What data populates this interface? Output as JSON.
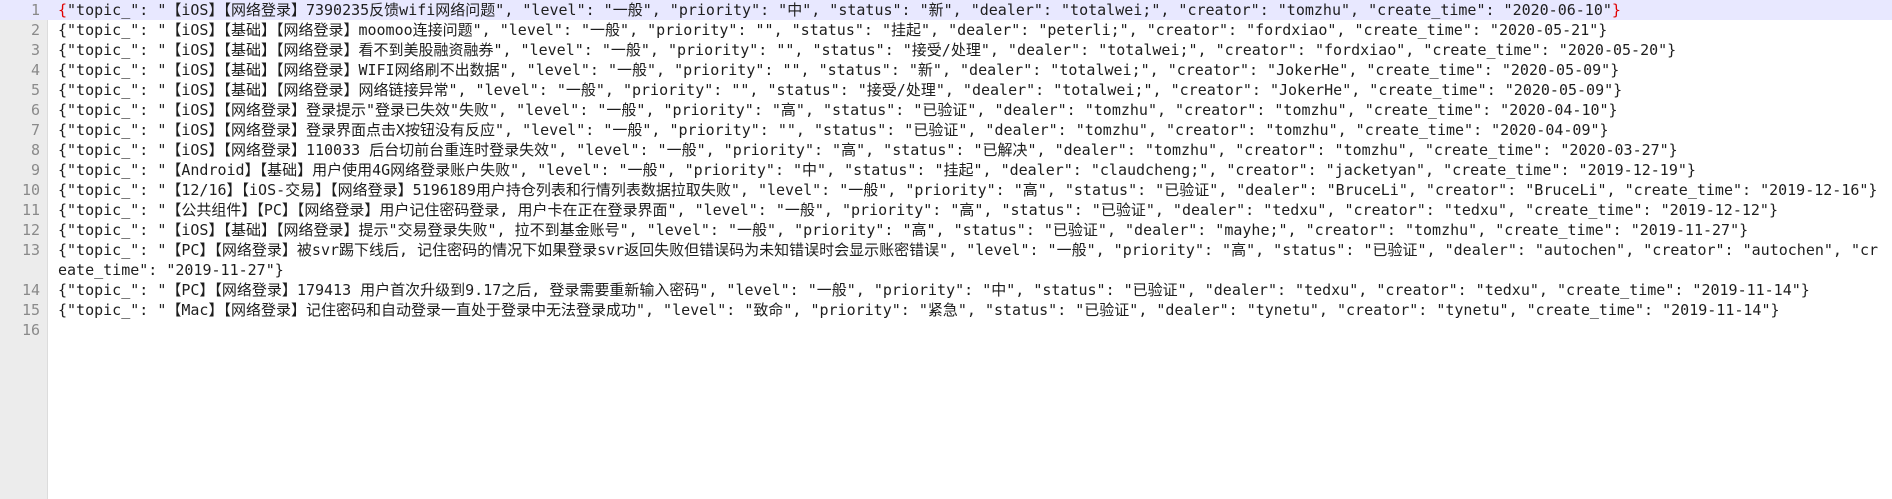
{
  "editor": {
    "lines": [
      {
        "number": "1",
        "open": "{",
        "text": "\"topic_\": \"【iOS】【网络登录】7390235反馈wifi网络问题\", \"level\": \"一般\", \"priority\": \"中\", \"status\": \"新\", \"dealer\": \"totalwei;\", \"creator\": \"tomzhu\", \"create_time\": \"2020-06-10\"",
        "close": "}"
      },
      {
        "number": "2",
        "open": "",
        "text": "{\"topic_\": \"【iOS】【基础】【网络登录】moomoo连接问题\", \"level\": \"一般\", \"priority\": \"\", \"status\": \"挂起\", \"dealer\": \"peterli;\", \"creator\": \"fordxiao\", \"create_time\": \"2020-05-21\"}",
        "close": ""
      },
      {
        "number": "3",
        "open": "",
        "text": "{\"topic_\": \"【iOS】【基础】【网络登录】看不到美股融资融券\", \"level\": \"一般\", \"priority\": \"\", \"status\": \"接受/处理\", \"dealer\": \"totalwei;\", \"creator\": \"fordxiao\", \"create_time\": \"2020-05-20\"}",
        "close": ""
      },
      {
        "number": "4",
        "open": "",
        "text": "{\"topic_\": \"【iOS】【基础】【网络登录】WIFI网络刷不出数据\", \"level\": \"一般\", \"priority\": \"\", \"status\": \"新\", \"dealer\": \"totalwei;\", \"creator\": \"JokerHe\", \"create_time\": \"2020-05-09\"}",
        "close": ""
      },
      {
        "number": "5",
        "open": "",
        "text": "{\"topic_\": \"【iOS】【基础】【网络登录】网络链接异常\", \"level\": \"一般\", \"priority\": \"\", \"status\": \"接受/处理\", \"dealer\": \"totalwei;\", \"creator\": \"JokerHe\", \"create_time\": \"2020-05-09\"}",
        "close": ""
      },
      {
        "number": "6",
        "open": "",
        "text": "{\"topic_\": \"【iOS】【网络登录】登录提示\"登录已失效\"失败\", \"level\": \"一般\", \"priority\": \"高\", \"status\": \"已验证\", \"dealer\": \"tomzhu\", \"creator\": \"tomzhu\", \"create_time\": \"2020-04-10\"}",
        "close": ""
      },
      {
        "number": "7",
        "open": "",
        "text": "{\"topic_\": \"【iOS】【网络登录】登录界面点击X按钮没有反应\", \"level\": \"一般\", \"priority\": \"\", \"status\": \"已验证\", \"dealer\": \"tomzhu\", \"creator\": \"tomzhu\", \"create_time\": \"2020-04-09\"}",
        "close": ""
      },
      {
        "number": "8",
        "open": "",
        "text": "{\"topic_\": \"【iOS】【网络登录】110033 后台切前台重连时登录失效\", \"level\": \"一般\", \"priority\": \"高\", \"status\": \"已解决\", \"dealer\": \"tomzhu\", \"creator\": \"tomzhu\", \"create_time\": \"2020-03-27\"}",
        "close": ""
      },
      {
        "number": "9",
        "open": "",
        "text": "{\"topic_\": \"【Android】【基础】用户使用4G网络登录账户失败\", \"level\": \"一般\", \"priority\": \"中\", \"status\": \"挂起\", \"dealer\": \"claudcheng;\", \"creator\": \"jacketyan\", \"create_time\": \"2019-12-19\"}",
        "close": ""
      },
      {
        "number": "10",
        "open": "",
        "text": "{\"topic_\": \"【12/16】【iOS-交易】【网络登录】5196189用户持仓列表和行情列表数据拉取失败\", \"level\": \"一般\", \"priority\": \"高\", \"status\": \"已验证\", \"dealer\": \"BruceLi\", \"creator\": \"BruceLi\", \"create_time\": \"2019-12-16\"}",
        "close": ""
      },
      {
        "number": "11",
        "open": "",
        "text": "{\"topic_\": \"【公共组件】【PC】【网络登录】用户记住密码登录, 用户卡在正在登录界面\", \"level\": \"一般\", \"priority\": \"高\", \"status\": \"已验证\", \"dealer\": \"tedxu\", \"creator\": \"tedxu\", \"create_time\": \"2019-12-12\"}",
        "close": ""
      },
      {
        "number": "12",
        "open": "",
        "text": "{\"topic_\": \"【iOS】【基础】【网络登录】提示\"交易登录失败\", 拉不到基金账号\", \"level\": \"一般\", \"priority\": \"高\", \"status\": \"已验证\", \"dealer\": \"mayhe;\", \"creator\": \"tomzhu\", \"create_time\": \"2019-11-27\"}",
        "close": ""
      },
      {
        "number": "13",
        "open": "",
        "text": "{\"topic_\": \"【PC】【网络登录】被svr踢下线后, 记住密码的情况下如果登录svr返回失败但错误码为未知错误时会显示账密错误\", \"level\": \"一般\", \"priority\": \"高\", \"status\": \"已验证\", \"dealer\": \"autochen\", \"creator\": \"autochen\", \"create_time\": \"2019-11-27\"}",
        "close": ""
      },
      {
        "number": "14",
        "open": "",
        "text": "{\"topic_\": \"【PC】【网络登录】179413 用户首次升级到9.17之后, 登录需要重新输入密码\", \"level\": \"一般\", \"priority\": \"中\", \"status\": \"已验证\", \"dealer\": \"tedxu\", \"creator\": \"tedxu\", \"create_time\": \"2019-11-14\"}",
        "close": ""
      },
      {
        "number": "15",
        "open": "",
        "text": "{\"topic_\": \"【Mac】【网络登录】记住密码和自动登录一直处于登录中无法登录成功\", \"level\": \"致命\", \"priority\": \"紧急\", \"status\": \"已验证\", \"dealer\": \"tynetu\", \"creator\": \"tynetu\", \"create_time\": \"2019-11-14\"}",
        "close": ""
      },
      {
        "number": "16",
        "open": "",
        "text": "",
        "close": ""
      }
    ]
  }
}
